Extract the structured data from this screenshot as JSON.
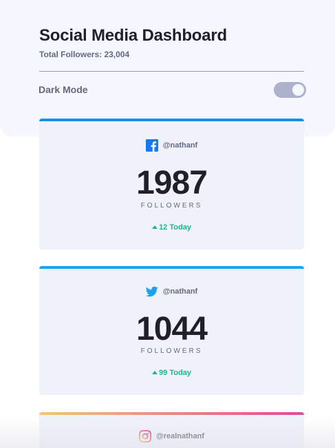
{
  "header": {
    "title": "Social Media Dashboard",
    "total_followers": "Total Followers: 23,004"
  },
  "dark_mode": {
    "label": "Dark Mode",
    "enabled": true
  },
  "cards": [
    {
      "platform": "facebook",
      "icon": "facebook-icon",
      "accent": "#178fe8",
      "handle": "@nathanf",
      "count": "1987",
      "label": "FOLLOWERS",
      "today": "12 Today"
    },
    {
      "platform": "twitter",
      "icon": "twitter-icon",
      "accent": "#1da1f2",
      "handle": "@nathanf",
      "count": "1044",
      "label": "FOLLOWERS",
      "today": "99 Today"
    },
    {
      "platform": "instagram",
      "icon": "instagram-icon",
      "accent": "#df4996",
      "handle": "@realnathanf"
    }
  ],
  "colors": {
    "positive": "#1eb589",
    "text_primary": "#1e202a",
    "text_secondary": "#63687e"
  }
}
